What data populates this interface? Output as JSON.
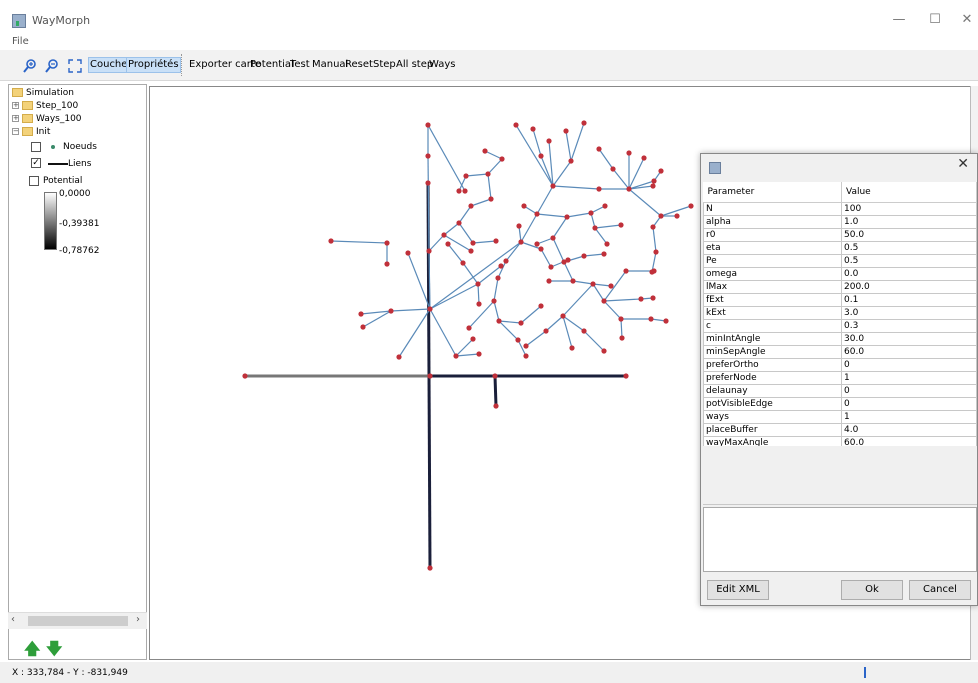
{
  "window": {
    "title": "WayMorph",
    "controls": {
      "minimize": "—",
      "maximize": "☐",
      "close": "✕"
    }
  },
  "menu": {
    "file": "File"
  },
  "toolbar": {
    "icons": [
      "zoom-in-icon",
      "zoom-out-icon",
      "fit-view-icon"
    ],
    "couches": "Couches",
    "proprietes": "Propriétés",
    "exporter_carte": "Exporter carte",
    "potential": "Potential",
    "test": "Test",
    "manual": "Manual",
    "reset": "Reset",
    "step": "Step",
    "all_step": "All step",
    "ways": "Ways"
  },
  "tree": {
    "root": "Simulation",
    "step": "Step_100",
    "ways": "Ways_100",
    "init": "Init",
    "noeuds": "Noeuds",
    "liens": "Liens",
    "potential": "Potential",
    "scale_max": "0,0000",
    "scale_mid": "-0,39381",
    "scale_min": "-0,78762"
  },
  "layers": {
    "noeuds_checked": false,
    "liens_checked": true,
    "potential_checked": false
  },
  "map": {
    "node_color": "#c0303a",
    "edge_color": "#5a8ab8",
    "road_color": "#1a1f3a"
  },
  "dialog": {
    "header_param": "Parameter",
    "header_value": "Value",
    "params": [
      {
        "name": "N",
        "value": "100"
      },
      {
        "name": "alpha",
        "value": "1.0"
      },
      {
        "name": "r0",
        "value": "50.0"
      },
      {
        "name": "eta",
        "value": "0.5"
      },
      {
        "name": "Pe",
        "value": "0.5"
      },
      {
        "name": "omega",
        "value": "0.0"
      },
      {
        "name": "lMax",
        "value": "200.0"
      },
      {
        "name": "fExt",
        "value": "0.1"
      },
      {
        "name": "kExt",
        "value": "3.0"
      },
      {
        "name": "c",
        "value": "0.3"
      },
      {
        "name": "minIntAngle",
        "value": "30.0"
      },
      {
        "name": "minSepAngle",
        "value": "60.0"
      },
      {
        "name": "preferOrtho",
        "value": "0"
      },
      {
        "name": "preferNode",
        "value": "1"
      },
      {
        "name": "delaunay",
        "value": "0"
      },
      {
        "name": "potVisibleEdge",
        "value": "0"
      },
      {
        "name": "ways",
        "value": "1"
      },
      {
        "name": "placeBuffer",
        "value": "4.0"
      },
      {
        "name": "wayMaxAngle",
        "value": "60.0"
      }
    ],
    "edit_xml": "Edit XML",
    "ok": "Ok",
    "cancel": "Cancel",
    "close": "✕"
  },
  "status": {
    "coords": "X : 333,784 - Y : -831,949"
  }
}
